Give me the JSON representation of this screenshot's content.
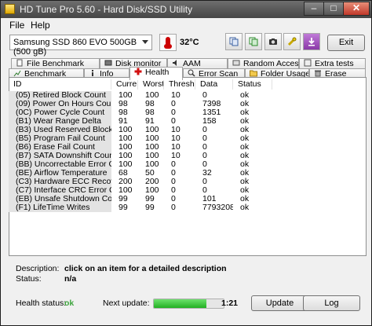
{
  "window": {
    "title": "HD Tune Pro 5.60 - Hard Disk/SSD Utility",
    "min": "–",
    "max": "□",
    "close": "✕"
  },
  "menu": [
    "File",
    "Help"
  ],
  "toolbar": {
    "drive": "Samsung SSD 860 EVO 500GB (500 gB)",
    "temperature": "32°C",
    "exit_label": "Exit",
    "icons": [
      "copy-icon",
      "save-icon",
      "screenshot-icon",
      "options-icon",
      "download-icon"
    ]
  },
  "tabs": {
    "row1": [
      "File Benchmark",
      "Disk monitor",
      "AAM",
      "Random Access",
      "Extra tests"
    ],
    "row2": [
      "Benchmark",
      "Info",
      "Health",
      "Error Scan",
      "Folder Usage",
      "Erase"
    ],
    "active": "Health"
  },
  "smart": {
    "columns": [
      "ID",
      "Current",
      "Worst",
      "Thresh...",
      "Data",
      "Status"
    ],
    "rows": [
      [
        "(05) Retired Block Count",
        "100",
        "100",
        "10",
        "0",
        "ok"
      ],
      [
        "(09) Power On Hours Count",
        "98",
        "98",
        "0",
        "7398",
        "ok"
      ],
      [
        "(0C) Power Cycle Count",
        "98",
        "98",
        "0",
        "1351",
        "ok"
      ],
      [
        "(B1) Wear Range Delta",
        "91",
        "91",
        "0",
        "158",
        "ok"
      ],
      [
        "(B3) Used Reserved Block C...",
        "100",
        "100",
        "10",
        "0",
        "ok"
      ],
      [
        "(B5) Program Fail Count",
        "100",
        "100",
        "10",
        "0",
        "ok"
      ],
      [
        "(B6) Erase Fail Count",
        "100",
        "100",
        "10",
        "0",
        "ok"
      ],
      [
        "(B7) SATA Downshift Count",
        "100",
        "100",
        "10",
        "0",
        "ok"
      ],
      [
        "(BB) Uncorrectable Error Cou...",
        "100",
        "100",
        "0",
        "0",
        "ok"
      ],
      [
        "(BE) Airflow Temperature",
        "68",
        "50",
        "0",
        "32",
        "ok"
      ],
      [
        "(C3) Hardware ECC Recover...",
        "200",
        "200",
        "0",
        "0",
        "ok"
      ],
      [
        "(C7) Interface CRC Error Count",
        "100",
        "100",
        "0",
        "0",
        "ok"
      ],
      [
        "(EB) Unsafe Shutdown Count",
        "99",
        "99",
        "0",
        "101",
        "ok"
      ],
      [
        "(F1) LifeTime Writes",
        "99",
        "99",
        "0",
        "77932084...",
        "ok"
      ]
    ]
  },
  "details": {
    "description_label": "Description:",
    "description": "click on an item for a detailed description",
    "status_label": "Status:",
    "status": "n/a"
  },
  "footer": {
    "health_label": "Health status:",
    "health": "ok",
    "next_label": "Next update:",
    "progress": 0.75,
    "time": "1:21",
    "update_label": "Update",
    "log_label": "Log"
  },
  "colors": {
    "health_ok": "#3fa63f",
    "progress": "#22b022"
  }
}
